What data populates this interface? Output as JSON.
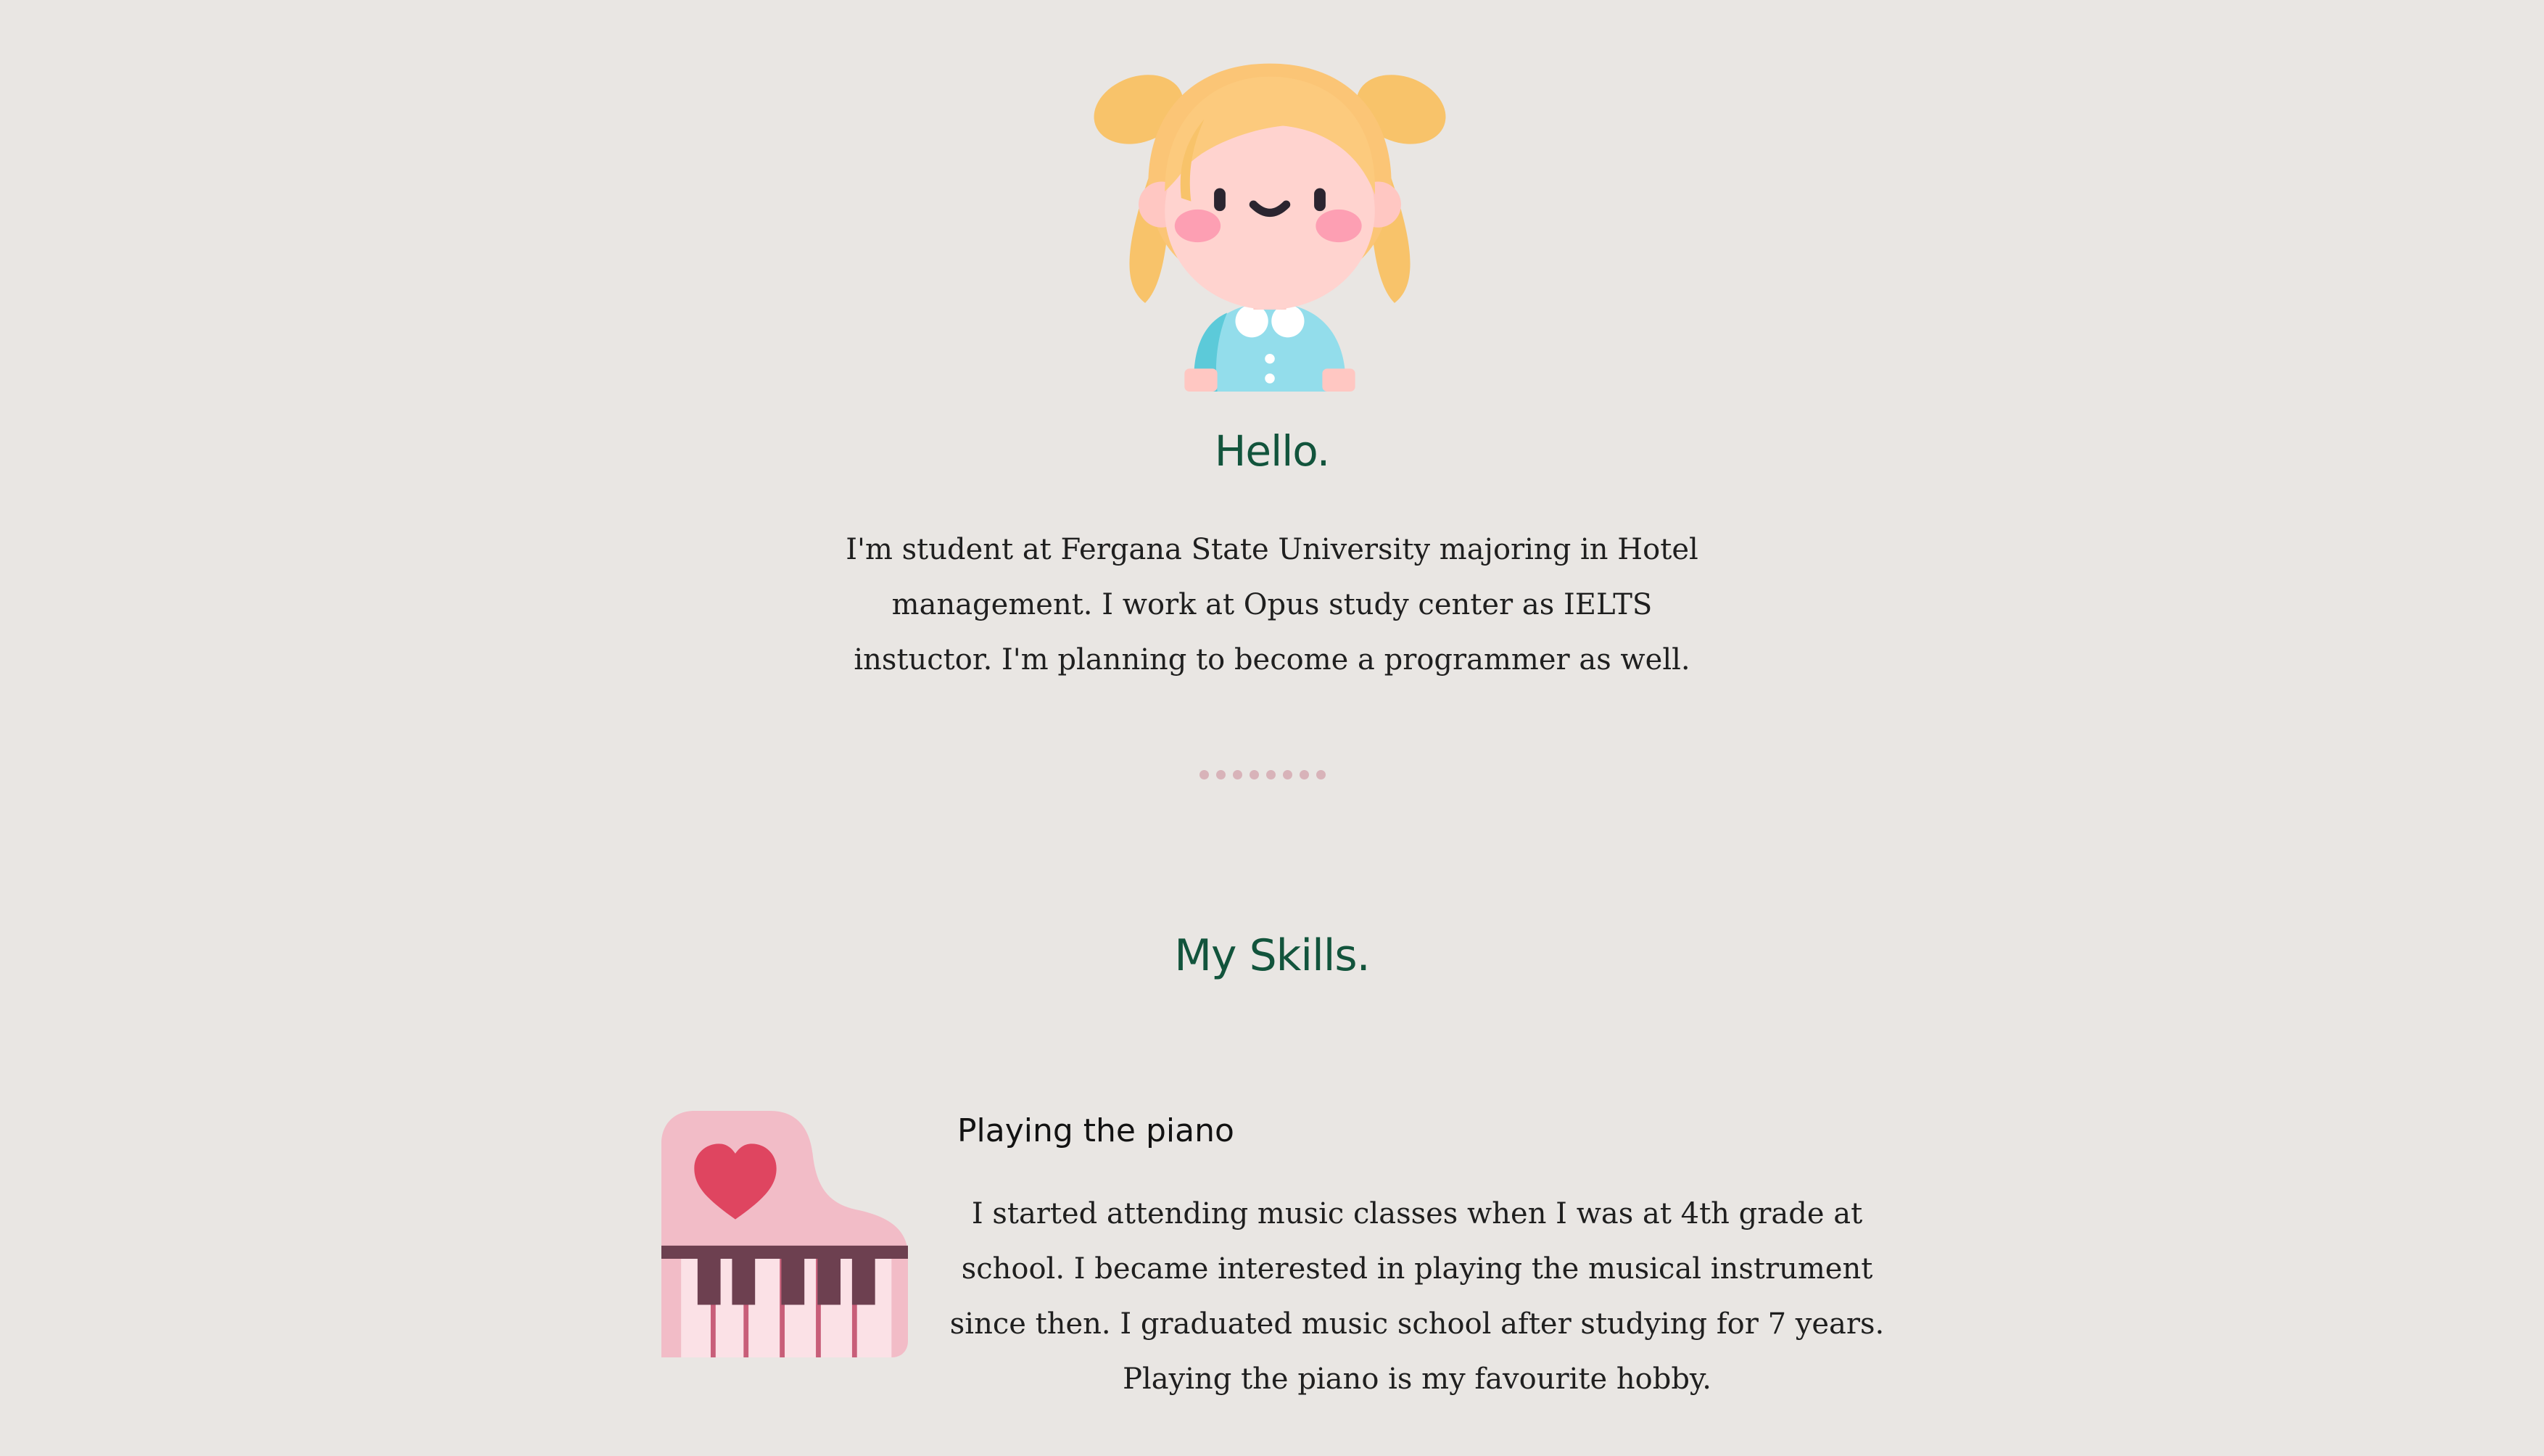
{
  "hero": {
    "avatar_icon": "girl-avatar-icon",
    "title": "Hello.",
    "intro": "I'm student at Fergana State University majoring in Hotel management. I work at Opus study center as IELTS instuctor. I'm planning to become a programmer as well."
  },
  "divider": {
    "dot_count": 8,
    "color": "#d8b3b9"
  },
  "skills": {
    "title": "My Skills.",
    "items": [
      {
        "icon": "grand-piano-heart-icon",
        "title": "Playing the piano",
        "description": "I started attending music classes when I was at 4th grade at school. I became interested in playing the musical instrument since then. I graduated music school after studying for 7 years. Playing the piano is my favourite hobby."
      }
    ]
  },
  "colors": {
    "background": "#e9e6e3",
    "heading": "#12543c",
    "text": "#1f1f1f"
  }
}
